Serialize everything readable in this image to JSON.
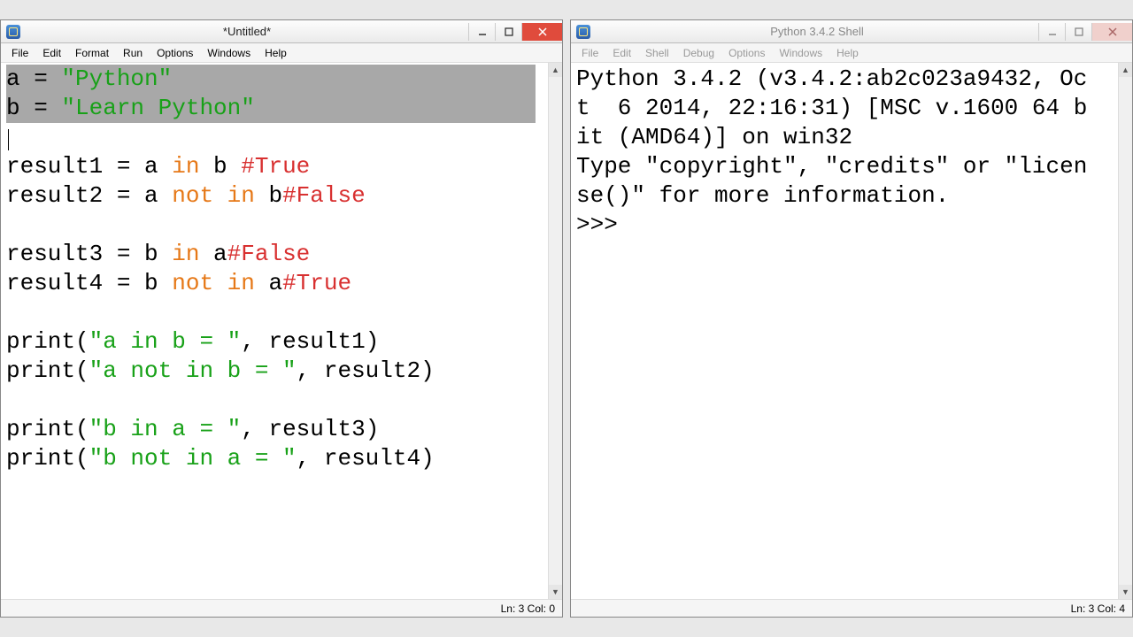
{
  "editor": {
    "title": "*Untitled*",
    "menus": [
      "File",
      "Edit",
      "Format",
      "Run",
      "Options",
      "Windows",
      "Help"
    ],
    "code": {
      "l1_a": "a = ",
      "l1_b": "\"Python\"",
      "l2_a": "b = ",
      "l2_b": "\"Learn Python\"",
      "l4_a": "result1 = a ",
      "l4_kw": "in",
      "l4_b": " b ",
      "l4_cm": "#True",
      "l5_a": "result2 = a ",
      "l5_kw": "not in",
      "l5_b": " b",
      "l5_cm": "#False",
      "l7_a": "result3 = b ",
      "l7_kw": "in",
      "l7_b": " a",
      "l7_cm": "#False",
      "l8_a": "result4 = b ",
      "l8_kw": "not in",
      "l8_b": " a",
      "l8_cm": "#True",
      "l10_a": "print(",
      "l10_s": "\"a in b = \"",
      "l10_b": ", result1)",
      "l11_a": "print(",
      "l11_s": "\"a not in b = \"",
      "l11_b": ", result2)",
      "l13_a": "print(",
      "l13_s": "\"b in a = \"",
      "l13_b": ", result3)",
      "l14_a": "print(",
      "l14_s": "\"b not in a = \"",
      "l14_b": ", result4)"
    },
    "status": "Ln: 3 Col: 0"
  },
  "shell": {
    "title": "Python 3.4.2 Shell",
    "menus": [
      "File",
      "Edit",
      "Shell",
      "Debug",
      "Options",
      "Windows",
      "Help"
    ],
    "banner1": "Python 3.4.2 (v3.4.2:ab2c023a9432, Oct  6 2014, 22:16:31) [MSC v.1600 64 bit (AMD64)] on win32",
    "banner2": "Type \"copyright\", \"credits\" or \"license()\" for more information.",
    "prompt": ">>> ",
    "status": "Ln: 3 Col: 4"
  }
}
